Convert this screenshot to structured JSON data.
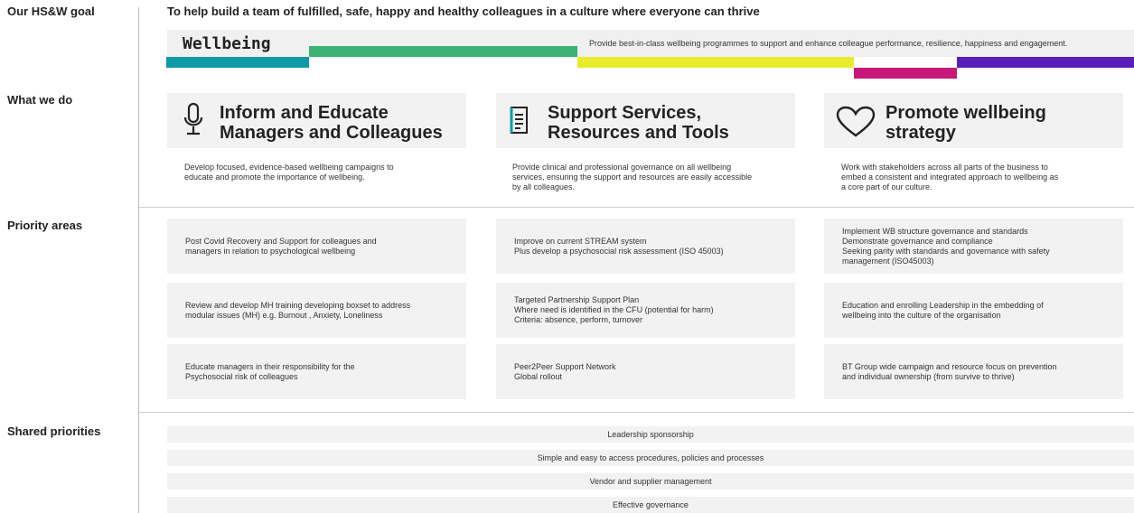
{
  "labels": {
    "goal": "Our HS&W goal",
    "what": "What we do",
    "priority": "Priority areas",
    "shared": "Shared priorities"
  },
  "goal_text": "To help build a team of fulfilled, safe, happy and healthy colleagues in a culture where everyone can thrive",
  "wellbeing": {
    "title": "Wellbeing",
    "description": "Provide best-in-class wellbeing programmes to support and enhance colleague performance, resilience, happiness and engagement.",
    "colors": [
      "#0e9aa7",
      "#3bb273",
      "#e8ec2c",
      "#c8187a",
      "#5a1fb8"
    ]
  },
  "what_we_do": [
    {
      "icon": "microphone-icon",
      "title_line1": "Inform and Educate",
      "title_line2": "Managers and Colleagues",
      "description": "Develop focused, evidence-based wellbeing campaigns to\neducate and promote the importance of wellbeing."
    },
    {
      "icon": "document-icon",
      "title_line1": "Support Services,",
      "title_line2": "Resources and Tools",
      "description": "Provide clinical and professional governance on all wellbeing\nservices, ensuring the support and resources are easily accessible\nby all colleagues."
    },
    {
      "icon": "heart-icon",
      "title_line1": "Promote wellbeing",
      "title_line2": "strategy",
      "description": "Work with stakeholders across all parts of the business to\nembed a consistent and integrated approach to wellbeing as\na core part of our culture."
    }
  ],
  "priority_areas": [
    [
      "Post Covid Recovery and Support for colleagues and\nmanagers in relation to psychological wellbeing",
      "Improve on current STREAM system\nPlus develop a psychosocial risk assessment (ISO 45003)",
      "Implement WB structure governance and standards\nDemonstrate governance and compliance\nSeeking parity with standards and governance with safety\nmanagement (ISO45003)"
    ],
    [
      "Review and develop MH training developing boxset to address\nmodular issues (MH) e.g. Burnout , Anxiety, Loneliness",
      "Targeted Partnership Support Plan\nWhere need is identified in the CFU (potential for harm)\nCriteria: absence, perform, turnover",
      "Education and enrolling Leadership in the embedding of\nwellbeing into the culture of the organisation"
    ],
    [
      "Educate managers in their responsibility for the\nPsychosocial risk of colleagues",
      "Peer2Peer Support Network\nGlobal rollout",
      "BT Group wide campaign and resource focus on prevention\nand individual ownership (from survive to thrive)"
    ]
  ],
  "shared_priorities": [
    "Leadership sponsorship",
    "Simple and easy to access procedures, policies and processes",
    "Vendor and supplier management",
    "Effective governance"
  ]
}
